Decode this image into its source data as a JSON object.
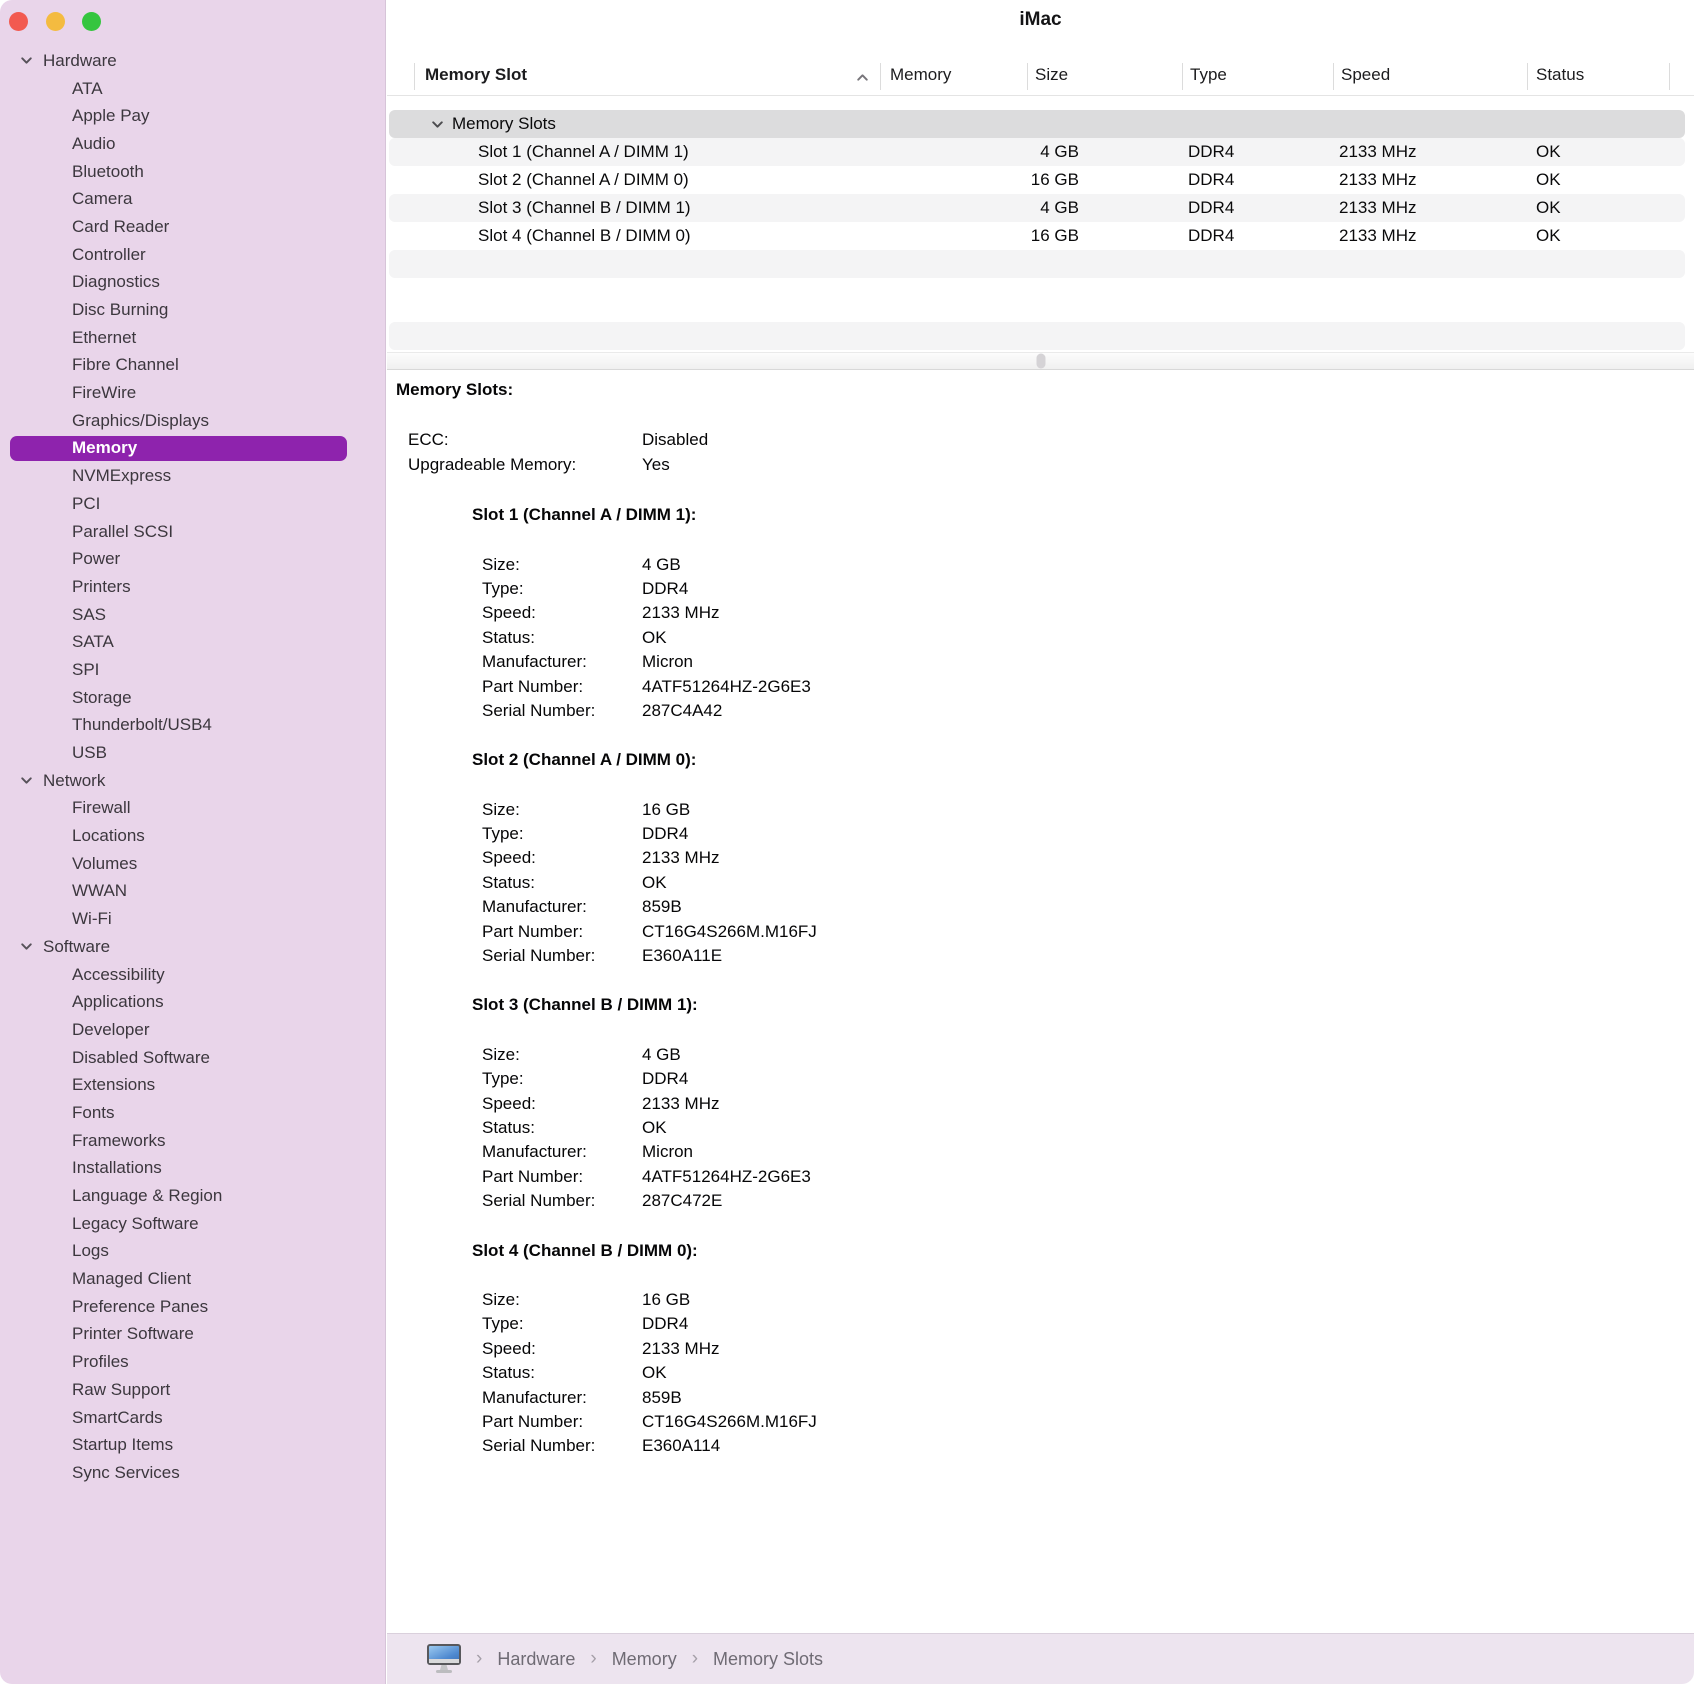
{
  "window": {
    "title": "iMac"
  },
  "colors": {
    "sidebar_bg": "#e9d5ea",
    "selection_purple": "#8e23ad",
    "group_row": "#dcdcdd",
    "row_stripe": "#f4f4f5",
    "bottom_bar": "#ede4ef",
    "traffic_red": "#f25a50",
    "traffic_yellow": "#f4bb40",
    "traffic_green": "#35c53f"
  },
  "icons": {
    "sidebar_disclosure": "chevron-down-icon",
    "group_disclosure": "chevron-down-icon",
    "sort_indicator": "chevron-up-icon",
    "breadcrumb_device": "imac-display-icon"
  },
  "sidebar": {
    "selected": "Memory",
    "sections": [
      {
        "label": "Hardware",
        "children": [
          "ATA",
          "Apple Pay",
          "Audio",
          "Bluetooth",
          "Camera",
          "Card Reader",
          "Controller",
          "Diagnostics",
          "Disc Burning",
          "Ethernet",
          "Fibre Channel",
          "FireWire",
          "Graphics/Displays",
          "Memory",
          "NVMExpress",
          "PCI",
          "Parallel SCSI",
          "Power",
          "Printers",
          "SAS",
          "SATA",
          "SPI",
          "Storage",
          "Thunderbolt/USB4",
          "USB"
        ]
      },
      {
        "label": "Network",
        "children": [
          "Firewall",
          "Locations",
          "Volumes",
          "WWAN",
          "Wi-Fi"
        ]
      },
      {
        "label": "Software",
        "children": [
          "Accessibility",
          "Applications",
          "Developer",
          "Disabled Software",
          "Extensions",
          "Fonts",
          "Frameworks",
          "Installations",
          "Language & Region",
          "Legacy Software",
          "Logs",
          "Managed Client",
          "Preference Panes",
          "Printer Software",
          "Profiles",
          "Raw Support",
          "SmartCards",
          "Startup Items",
          "Sync Services"
        ]
      }
    ]
  },
  "table": {
    "columns": [
      "Memory Slot",
      "Memory",
      "Size",
      "Type",
      "Speed",
      "Status"
    ],
    "sort_column": "Memory Slot",
    "sort_direction": "ascending",
    "group_label": "Memory Slots",
    "rows": [
      {
        "slot": "Slot 1 (Channel A / DIMM 1)",
        "memory": "",
        "size": "4 GB",
        "type": "DDR4",
        "speed": "2133 MHz",
        "status": "OK"
      },
      {
        "slot": "Slot 2 (Channel A / DIMM 0)",
        "memory": "",
        "size": "16 GB",
        "type": "DDR4",
        "speed": "2133 MHz",
        "status": "OK"
      },
      {
        "slot": "Slot 3 (Channel B / DIMM 1)",
        "memory": "",
        "size": "4 GB",
        "type": "DDR4",
        "speed": "2133 MHz",
        "status": "OK"
      },
      {
        "slot": "Slot 4 (Channel B / DIMM 0)",
        "memory": "",
        "size": "16 GB",
        "type": "DDR4",
        "speed": "2133 MHz",
        "status": "OK"
      }
    ]
  },
  "details": {
    "heading": "Memory Slots:",
    "summary": [
      {
        "label": "ECC:",
        "value": "Disabled"
      },
      {
        "label": "Upgradeable Memory:",
        "value": "Yes"
      }
    ],
    "slots": [
      {
        "heading": "Slot 1 (Channel A / DIMM 1):",
        "fields": [
          [
            "Size:",
            "4 GB"
          ],
          [
            "Type:",
            "DDR4"
          ],
          [
            "Speed:",
            "2133 MHz"
          ],
          [
            "Status:",
            "OK"
          ],
          [
            "Manufacturer:",
            "Micron"
          ],
          [
            "Part Number:",
            "4ATF51264HZ-2G6E3"
          ],
          [
            "Serial Number:",
            "287C4A42"
          ]
        ]
      },
      {
        "heading": "Slot 2 (Channel A / DIMM 0):",
        "fields": [
          [
            "Size:",
            "16 GB"
          ],
          [
            "Type:",
            "DDR4"
          ],
          [
            "Speed:",
            "2133 MHz"
          ],
          [
            "Status:",
            "OK"
          ],
          [
            "Manufacturer:",
            "859B"
          ],
          [
            "Part Number:",
            "CT16G4S266M.M16FJ"
          ],
          [
            "Serial Number:",
            "E360A11E"
          ]
        ]
      },
      {
        "heading": "Slot 3 (Channel B / DIMM 1):",
        "fields": [
          [
            "Size:",
            "4 GB"
          ],
          [
            "Type:",
            "DDR4"
          ],
          [
            "Speed:",
            "2133 MHz"
          ],
          [
            "Status:",
            "OK"
          ],
          [
            "Manufacturer:",
            "Micron"
          ],
          [
            "Part Number:",
            "4ATF51264HZ-2G6E3"
          ],
          [
            "Serial Number:",
            "287C472E"
          ]
        ]
      },
      {
        "heading": "Slot 4 (Channel B / DIMM 0):",
        "fields": [
          [
            "Size:",
            "16 GB"
          ],
          [
            "Type:",
            "DDR4"
          ],
          [
            "Speed:",
            "2133 MHz"
          ],
          [
            "Status:",
            "OK"
          ],
          [
            "Manufacturer:",
            "859B"
          ],
          [
            "Part Number:",
            "CT16G4S266M.M16FJ"
          ],
          [
            "Serial Number:",
            "E360A114"
          ]
        ]
      }
    ]
  },
  "breadcrumb": {
    "items": [
      "Hardware",
      "Memory",
      "Memory Slots"
    ]
  }
}
